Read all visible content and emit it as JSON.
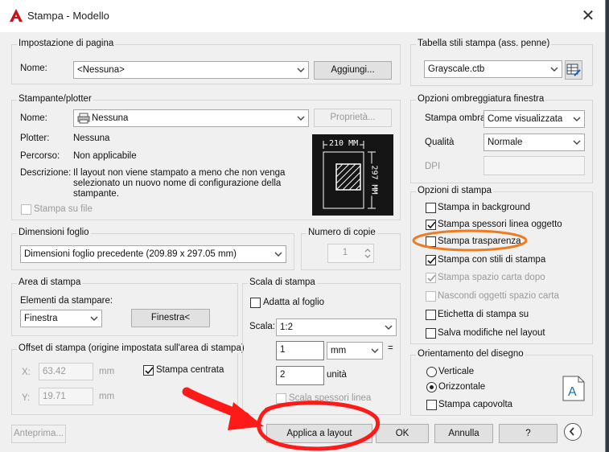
{
  "window": {
    "title": "Stampa - Modello",
    "close": "✕"
  },
  "page_setup": {
    "group": "Impostazione di pagina",
    "name_label": "Nome:",
    "name_value": "<Nessuna>",
    "add_button": "Aggiungi..."
  },
  "printer": {
    "group": "Stampante/plotter",
    "name_label": "Nome:",
    "name_value": "Nessuna",
    "properties_button": "Proprietà...",
    "plotter_label": "Plotter:",
    "plotter_value": "Nessuna",
    "path_label": "Percorso:",
    "path_value": "Non applicabile",
    "desc_label": "Descrizione:",
    "desc_line1": "Il layout non viene stampato a meno che non venga",
    "desc_line2": "selezionato un nuovo nome di configurazione della",
    "desc_line3": "stampante.",
    "print_to_file": "Stampa su file",
    "preview_width": "210 MM",
    "preview_height": "297 MM"
  },
  "paper_size": {
    "group": "Dimensioni foglio",
    "value": "Dimensioni foglio precedente (209.89 x 297.05 mm)"
  },
  "copies": {
    "group": "Numero di copie",
    "value": "1"
  },
  "plot_area": {
    "group": "Area di stampa",
    "items_label": "Elementi da stampare:",
    "items_value": "Finestra",
    "window_button": "Finestra<"
  },
  "plot_offset": {
    "group": "Offset di stampa (origine impostata sull'area di stampa)",
    "x_label": "X:",
    "x_value": "63.42",
    "x_unit": "mm",
    "y_label": "Y:",
    "y_value": "19.71",
    "y_unit": "mm",
    "center_label": "Stampa centrata"
  },
  "plot_scale": {
    "group": "Scala di stampa",
    "fit_label": "Adatta al foglio",
    "scale_label": "Scala:",
    "scale_value": "1:2",
    "value1": "1",
    "unit1": "mm",
    "equals": "=",
    "value2": "2",
    "unit2": "unità",
    "lineweights_label": "Scala spessori linea"
  },
  "style_table": {
    "group": "Tabella stili stampa (ass. penne)",
    "value": "Grayscale.ctb"
  },
  "shaded": {
    "group": "Opzioni ombreggiatura finestra",
    "shade_label": "Stampa ombra",
    "shade_value": "Come visualizzata",
    "quality_label": "Qualità",
    "quality_value": "Normale",
    "dpi_label": "DPI"
  },
  "plot_options": {
    "group": "Opzioni di stampa",
    "items": [
      {
        "label": "Stampa in background",
        "checked": false,
        "disabled": false
      },
      {
        "label": "Stampa spessori linea oggetto",
        "checked": true,
        "disabled": false
      },
      {
        "label": "Stampa trasparenza",
        "checked": false,
        "disabled": false
      },
      {
        "label": "Stampa con stili di stampa",
        "checked": true,
        "disabled": false
      },
      {
        "label": "Stampa spazio carta dopo",
        "checked": true,
        "disabled": true
      },
      {
        "label": "Nascondi oggetti spazio carta",
        "checked": false,
        "disabled": true
      },
      {
        "label": "Etichetta di stampa su",
        "checked": false,
        "disabled": false
      },
      {
        "label": "Salva modifiche nel layout",
        "checked": false,
        "disabled": false
      }
    ]
  },
  "orientation": {
    "group": "Orientamento del disegno",
    "portrait": "Verticale",
    "landscape": "Orizzontale",
    "upside_down": "Stampa capovolta"
  },
  "footer": {
    "preview": "Anteprima...",
    "apply": "Applica a layout",
    "ok": "OK",
    "cancel": "Annulla",
    "help": "?"
  },
  "colors": {
    "annotation": "#ff1a1a",
    "highlight": "#f07a1e",
    "title_icon": "#c4151c"
  }
}
